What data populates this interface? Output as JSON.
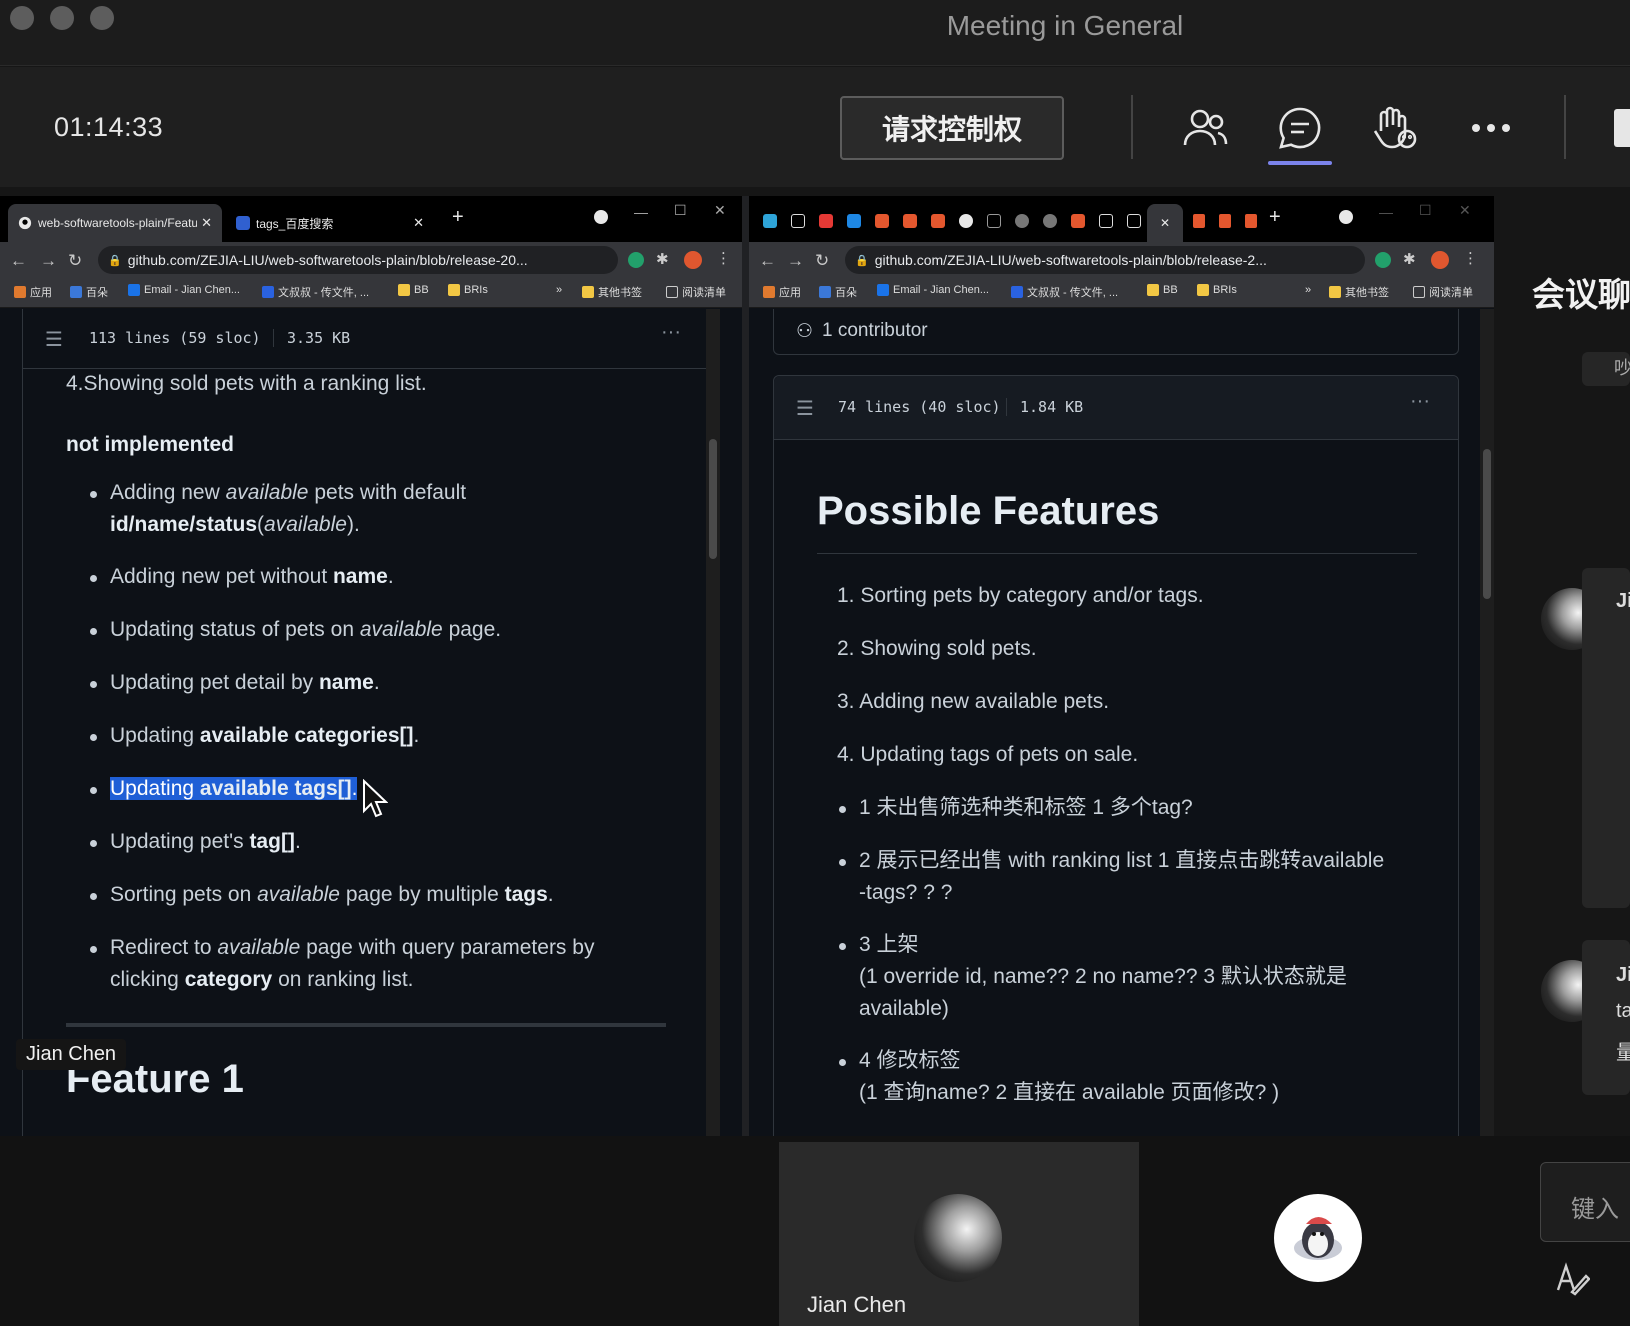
{
  "window": {
    "title": "Meeting in General"
  },
  "toolbar": {
    "timer": "01:14:33",
    "request_control_label": "请求控制权",
    "icons": [
      "people-icon",
      "chat-icon",
      "raise-hand-icon",
      "more-icon"
    ]
  },
  "left_browser": {
    "tabs": [
      {
        "label": "web-softwaretools-plain/Featu",
        "active": true
      },
      {
        "label": "tags_百度搜索",
        "active": false
      }
    ],
    "url": "github.com/ZEJIA-LIU/web-softwaretools-plain/blob/release-20...",
    "bookmarks": [
      "应用",
      "百朵",
      "Email - Jian Chen...",
      "文叔叔 - 传文件, ...",
      "BB",
      "BRIs",
      "»",
      "其他书签",
      "阅读清单"
    ],
    "file_info": {
      "lines": "113 lines (59 sloc)",
      "size": "3.35 KB"
    },
    "content": {
      "intro": "4.Showing sold pets with a ranking list.",
      "subheading": "not implemented",
      "items": [
        [
          "Adding new ",
          "available",
          " pets with default"
        ],
        [
          "id/name/status",
          "(",
          "available",
          ")."
        ],
        [
          "Adding new pet without ",
          "name",
          "."
        ],
        [
          "Updating status of pets on ",
          "available",
          " page."
        ],
        [
          "Updating pet detail by ",
          "name",
          "."
        ],
        [
          "Updating ",
          "available categories[]",
          "."
        ],
        [
          "Updating ",
          "available tags[]",
          "."
        ],
        [
          "Updating pet's ",
          "tag[]",
          "."
        ],
        [
          "Sorting pets on ",
          "available",
          " page by multiple ",
          "tags",
          "."
        ],
        [
          "Redirect to ",
          "available",
          " page with query parameters by"
        ],
        [
          "clicking ",
          "category",
          " on ranking list."
        ]
      ],
      "next_heading": "Feature 1"
    },
    "presenter_name": "Jian Chen"
  },
  "right_browser": {
    "url": "github.com/ZEJIA-LIU/web-softwaretools-plain/blob/release-2...",
    "bookmarks": [
      "应用",
      "百朵",
      "Email - Jian Chen...",
      "文叔叔 - 传文件, ...",
      "BB",
      "BRIs",
      "»",
      "其他书签",
      "阅读清单"
    ],
    "contributors": "1 contributor",
    "file_info": {
      "lines": "74 lines (40 sloc)",
      "size": "1.84 KB"
    },
    "heading": "Possible Features",
    "ordered": [
      "1. Sorting pets by category and/or tags.",
      "2. Showing sold pets.",
      "3. Adding new available pets.",
      "4. Updating tags of pets on sale."
    ],
    "notes": [
      "1 未出售筛选种类和标签 1 多个tag?",
      "2 展示已经出售 with ranking list 1 直接点击跳转available",
      "-tags? ? ?",
      "3 上架",
      "(1 override id, name?? 2 no name?? 3 默认状态就是",
      "available)",
      "4 修改标签",
      "(1 查询name?   2 直接在 available 页面修改? )"
    ]
  },
  "chat_panel": {
    "title": "会议聊",
    "fragments": [
      "Ji",
      "Ji",
      "ta",
      "量",
      "吵"
    ]
  },
  "participants": [
    {
      "name": "Jian Chen"
    }
  ],
  "compose": {
    "placeholder": "键入"
  }
}
